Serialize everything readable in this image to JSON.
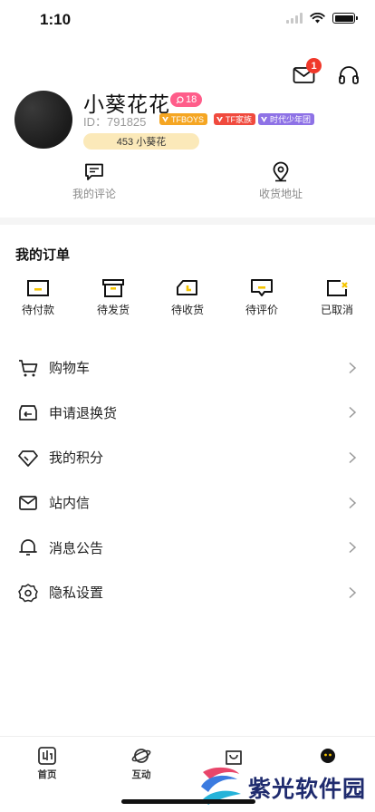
{
  "status_bar": {
    "time": "1:10"
  },
  "header": {
    "mail_badge_count": "1"
  },
  "profile": {
    "username": "小葵花花",
    "level": "18",
    "user_id": "ID：791825",
    "tags": [
      "TFBOYS",
      "TF家族",
      "时代少年团"
    ],
    "tag_colors": [
      "#f5a623",
      "#f04a3e",
      "#8e72e6"
    ],
    "fan_pill": "453 小葵花"
  },
  "quick_links": [
    {
      "label": "我的评论",
      "icon": "comment-icon"
    },
    {
      "label": "收货地址",
      "icon": "location-pin-icon"
    }
  ],
  "orders": {
    "title": "我的订单",
    "items": [
      {
        "label": "待付款",
        "icon": "wallet-icon"
      },
      {
        "label": "待发货",
        "icon": "box-icon"
      },
      {
        "label": "待收货",
        "icon": "truck-icon"
      },
      {
        "label": "待评价",
        "icon": "review-icon"
      },
      {
        "label": "已取消",
        "icon": "cancelled-icon"
      }
    ]
  },
  "menu": [
    {
      "label": "购物车",
      "icon": "cart-icon"
    },
    {
      "label": "申请退换货",
      "icon": "return-icon"
    },
    {
      "label": "我的积分",
      "icon": "diamond-icon"
    },
    {
      "label": "站内信",
      "icon": "envelope-icon"
    },
    {
      "label": "消息公告",
      "icon": "bell-icon"
    },
    {
      "label": "隐私设置",
      "icon": "gear-icon"
    }
  ],
  "tabbar": [
    {
      "label": "首页",
      "icon": "home-icon"
    },
    {
      "label": "互动",
      "icon": "planet-icon"
    },
    {
      "label": "",
      "icon": "shop-bag-icon"
    },
    {
      "label": "",
      "icon": "profile-face-icon"
    }
  ],
  "watermark": {
    "text": "紫光软件园"
  },
  "colors": {
    "accent_yellow": "#f5c400",
    "badge_red": "#f0382a",
    "level_pink": "#ff5d8a",
    "fan_pill_bg": "#fbe9b9"
  }
}
